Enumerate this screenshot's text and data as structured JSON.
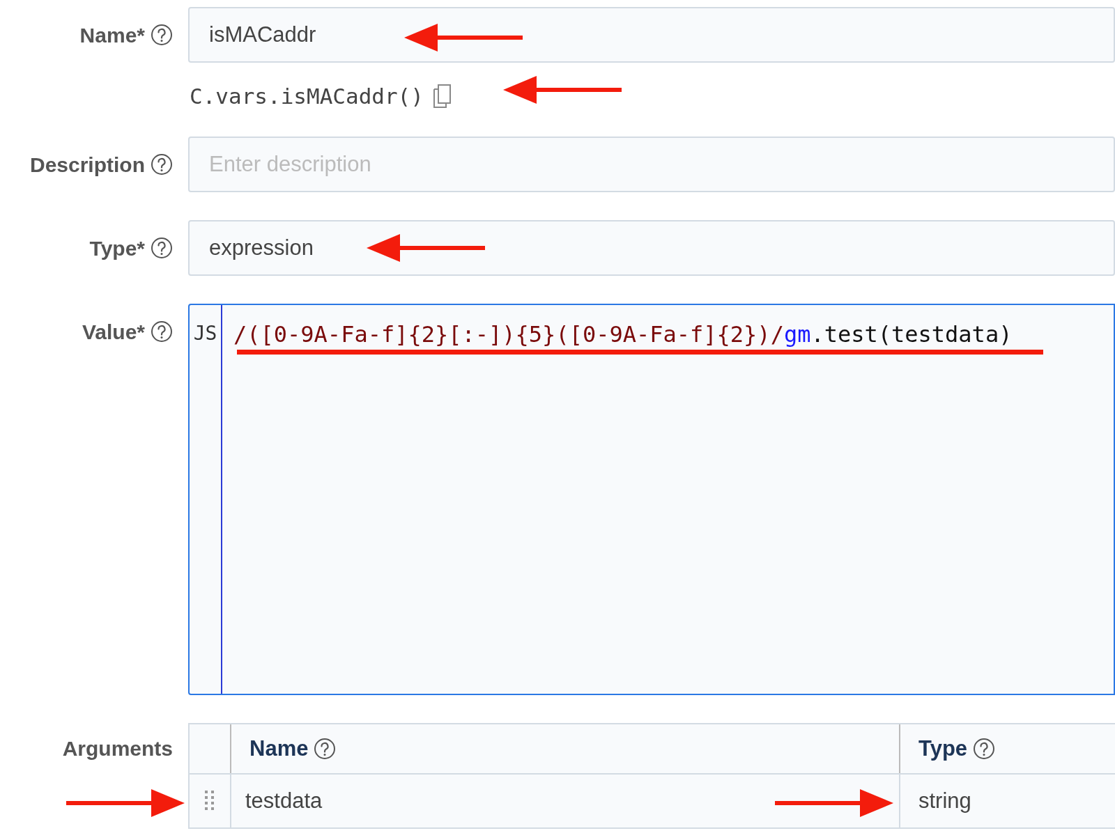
{
  "fields": [
    {
      "kind": "text",
      "label": "Name*",
      "value": "isMACaddr"
    },
    {
      "kind": "text",
      "label": "Description",
      "placeholder": "Enter description"
    },
    {
      "kind": "text",
      "label": "Type*",
      "value": "expression"
    },
    {
      "kind": "code",
      "label": "Value*",
      "language": "JS",
      "segments": [
        {
          "kind": "regex",
          "text": "/([0-9A-Fa-f]{2}[:-]){5}([0-9A-Fa-f]{2})/"
        },
        {
          "kind": "flag",
          "text": "gm"
        },
        {
          "kind": "plain",
          "text": ".test(testdata)"
        }
      ]
    }
  ],
  "reference": "C.vars.isMACaddr()",
  "arguments": {
    "label": "Arguments",
    "columns": [
      "Name",
      "Type"
    ],
    "rows": [
      [
        "testdata",
        "string"
      ]
    ]
  }
}
